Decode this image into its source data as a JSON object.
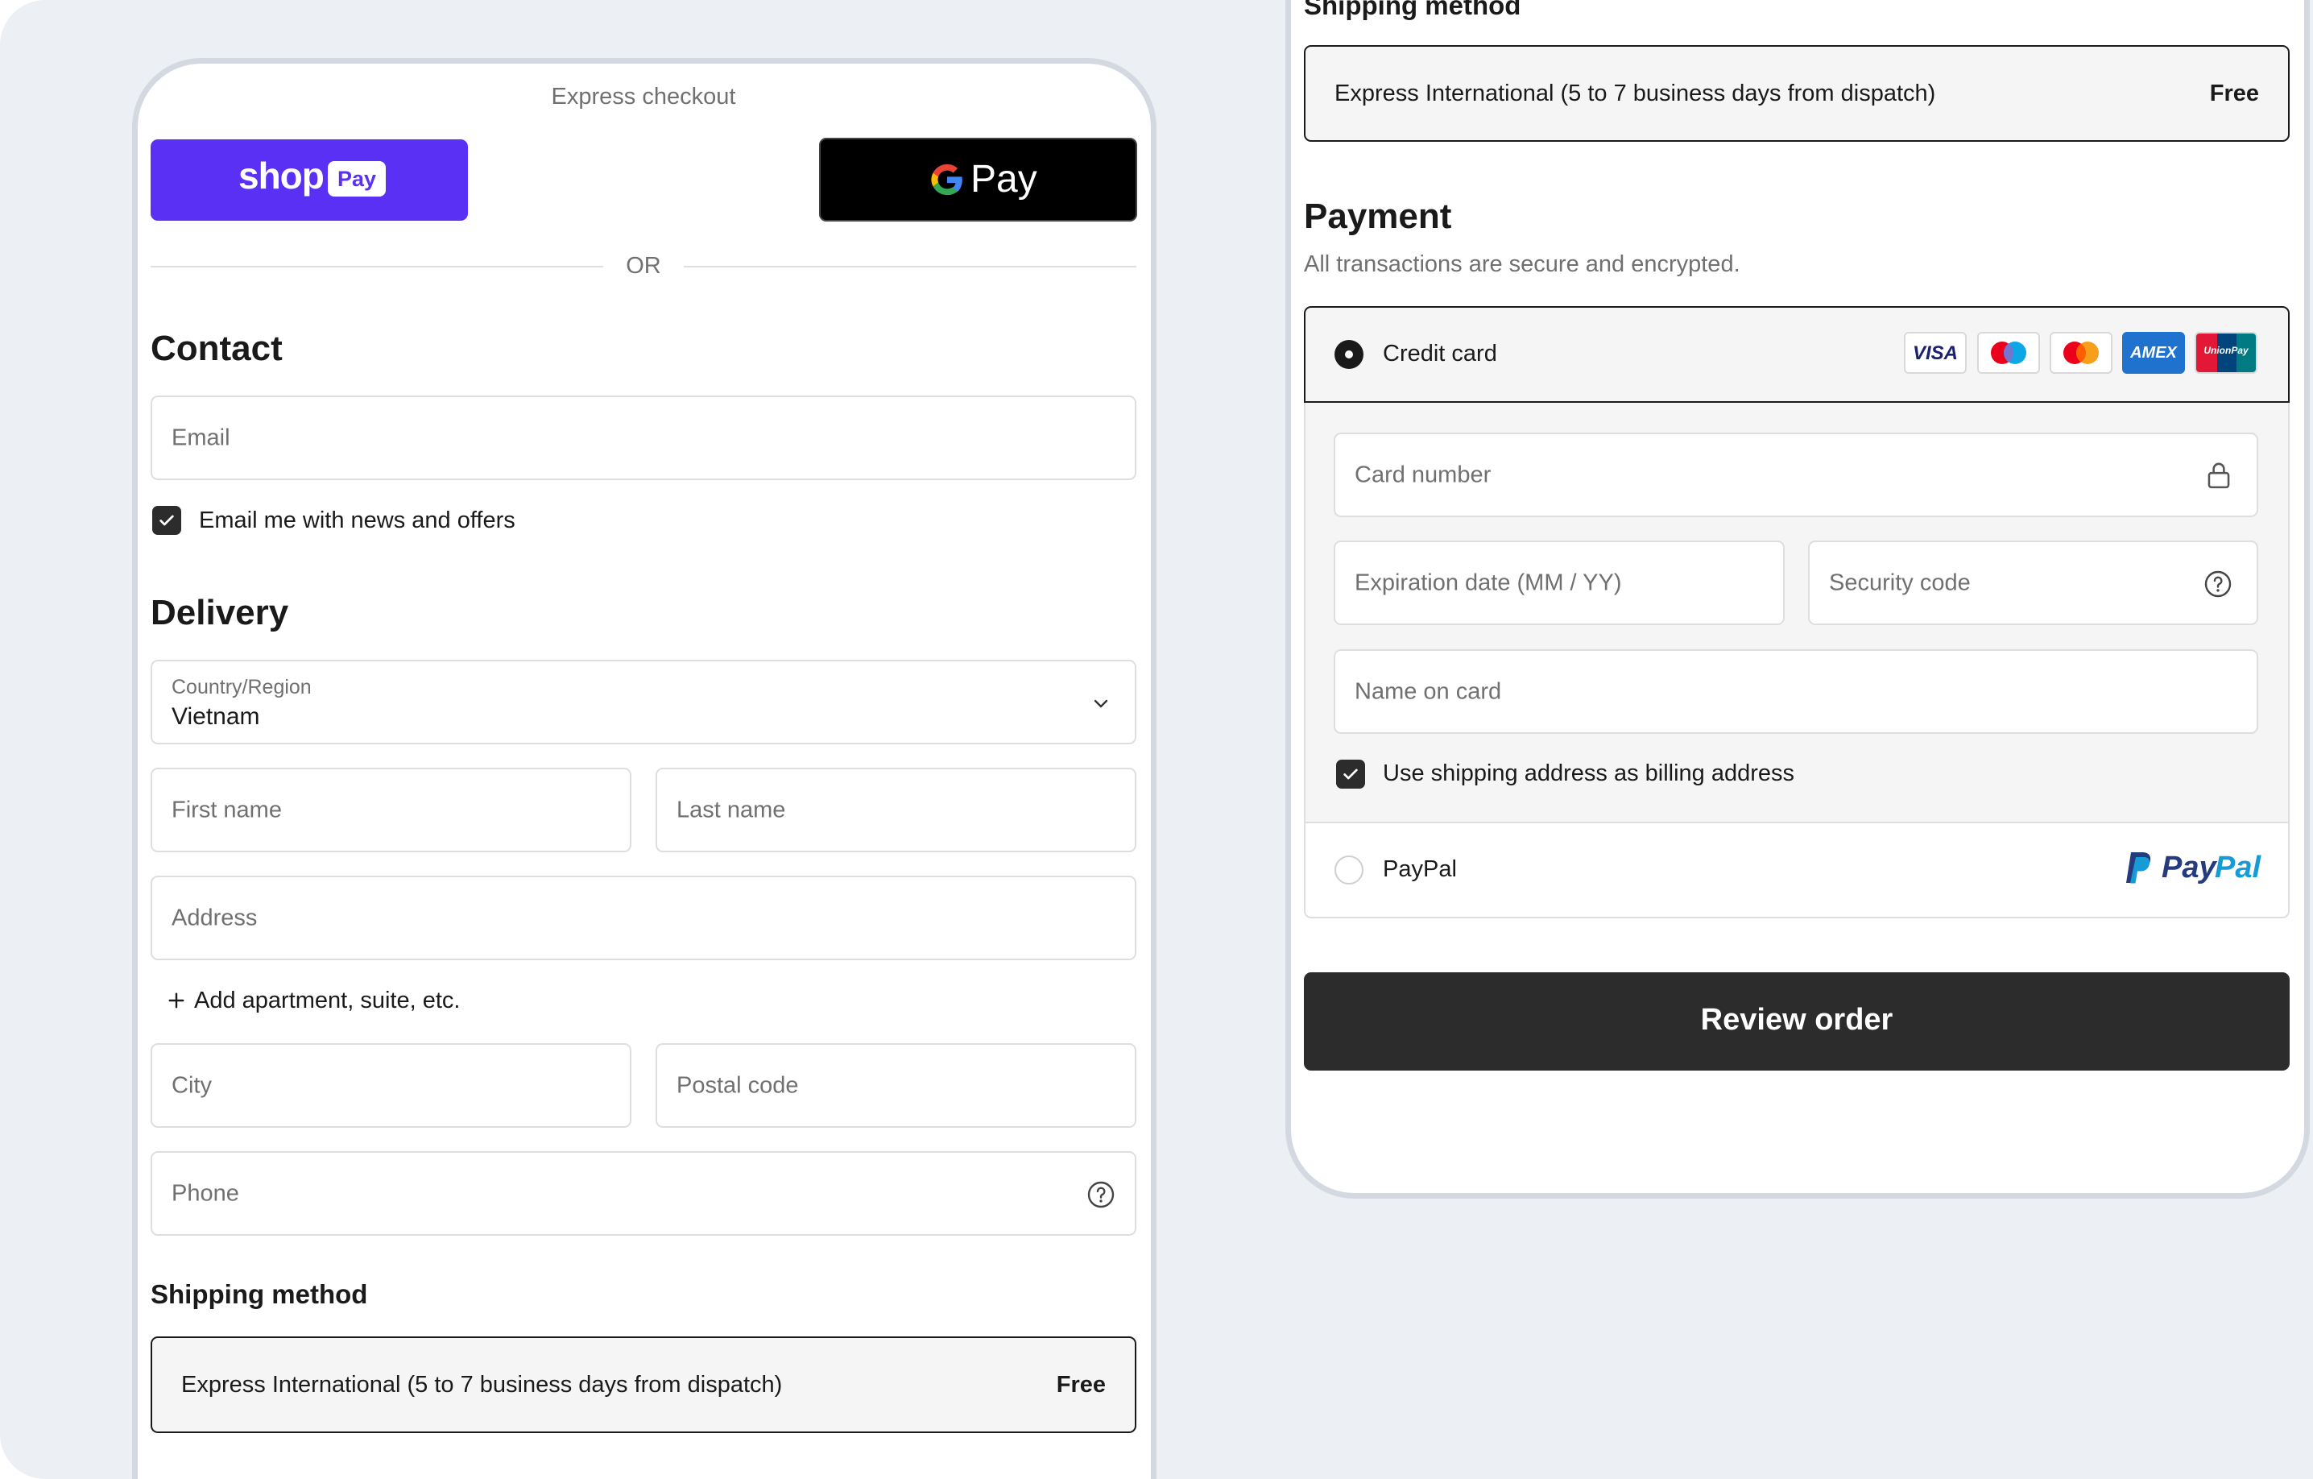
{
  "left": {
    "express_checkout_label": "Express checkout",
    "shop_pay": {
      "brand": "shop",
      "badge": "Pay"
    },
    "google_pay": {
      "label": "Pay"
    },
    "divider_label": "OR",
    "contact": {
      "heading": "Contact",
      "email_placeholder": "Email",
      "newsletter_label": "Email me with news and offers",
      "newsletter_checked": true
    },
    "delivery": {
      "heading": "Delivery",
      "country_label": "Country/Region",
      "country_value": "Vietnam",
      "first_name_placeholder": "First name",
      "last_name_placeholder": "Last name",
      "address_placeholder": "Address",
      "add_apartment_label": "Add apartment, suite, etc.",
      "city_placeholder": "City",
      "postal_code_placeholder": "Postal code",
      "phone_placeholder": "Phone"
    },
    "shipping": {
      "heading": "Shipping method",
      "option_label": "Express International (5 to 7 business days from dispatch)",
      "option_price": "Free"
    }
  },
  "right": {
    "shipping": {
      "heading": "Shipping method",
      "option_label": "Express International (5 to 7 business days from dispatch)",
      "option_price": "Free"
    },
    "payment": {
      "heading": "Payment",
      "subtitle": "All transactions are secure and encrypted.",
      "credit_card_label": "Credit card",
      "card_brands": [
        "VISA",
        "Maestro",
        "Mastercard",
        "AMEX",
        "UnionPay"
      ],
      "visa_text": "VISA",
      "amex_text": "AMEX",
      "unionpay_text": "UnionPay",
      "card_number_placeholder": "Card number",
      "expiration_placeholder": "Expiration date (MM / YY)",
      "security_code_placeholder": "Security code",
      "name_on_card_placeholder": "Name on card",
      "billing_same_label": "Use shipping address as billing address",
      "billing_same_checked": true,
      "paypal_label": "PayPal",
      "paypal_logo_pay": "Pay",
      "paypal_logo_pal": "Pal",
      "selected_method": "Credit card"
    },
    "review_button_label": "Review order"
  },
  "colors": {
    "shop_pay": "#5a31f4",
    "google_pay_bg": "#000000",
    "primary_button": "#2c2c2c",
    "page_bg": "#eceff3",
    "selected_bg": "#f5f5f5",
    "paypal_dark": "#253b80",
    "paypal_light": "#179bd7"
  },
  "icons": [
    "check-icon",
    "chevron-down-icon",
    "plus-icon",
    "help-circle-icon",
    "lock-icon",
    "google-g-icon",
    "paypal-p-icon"
  ]
}
